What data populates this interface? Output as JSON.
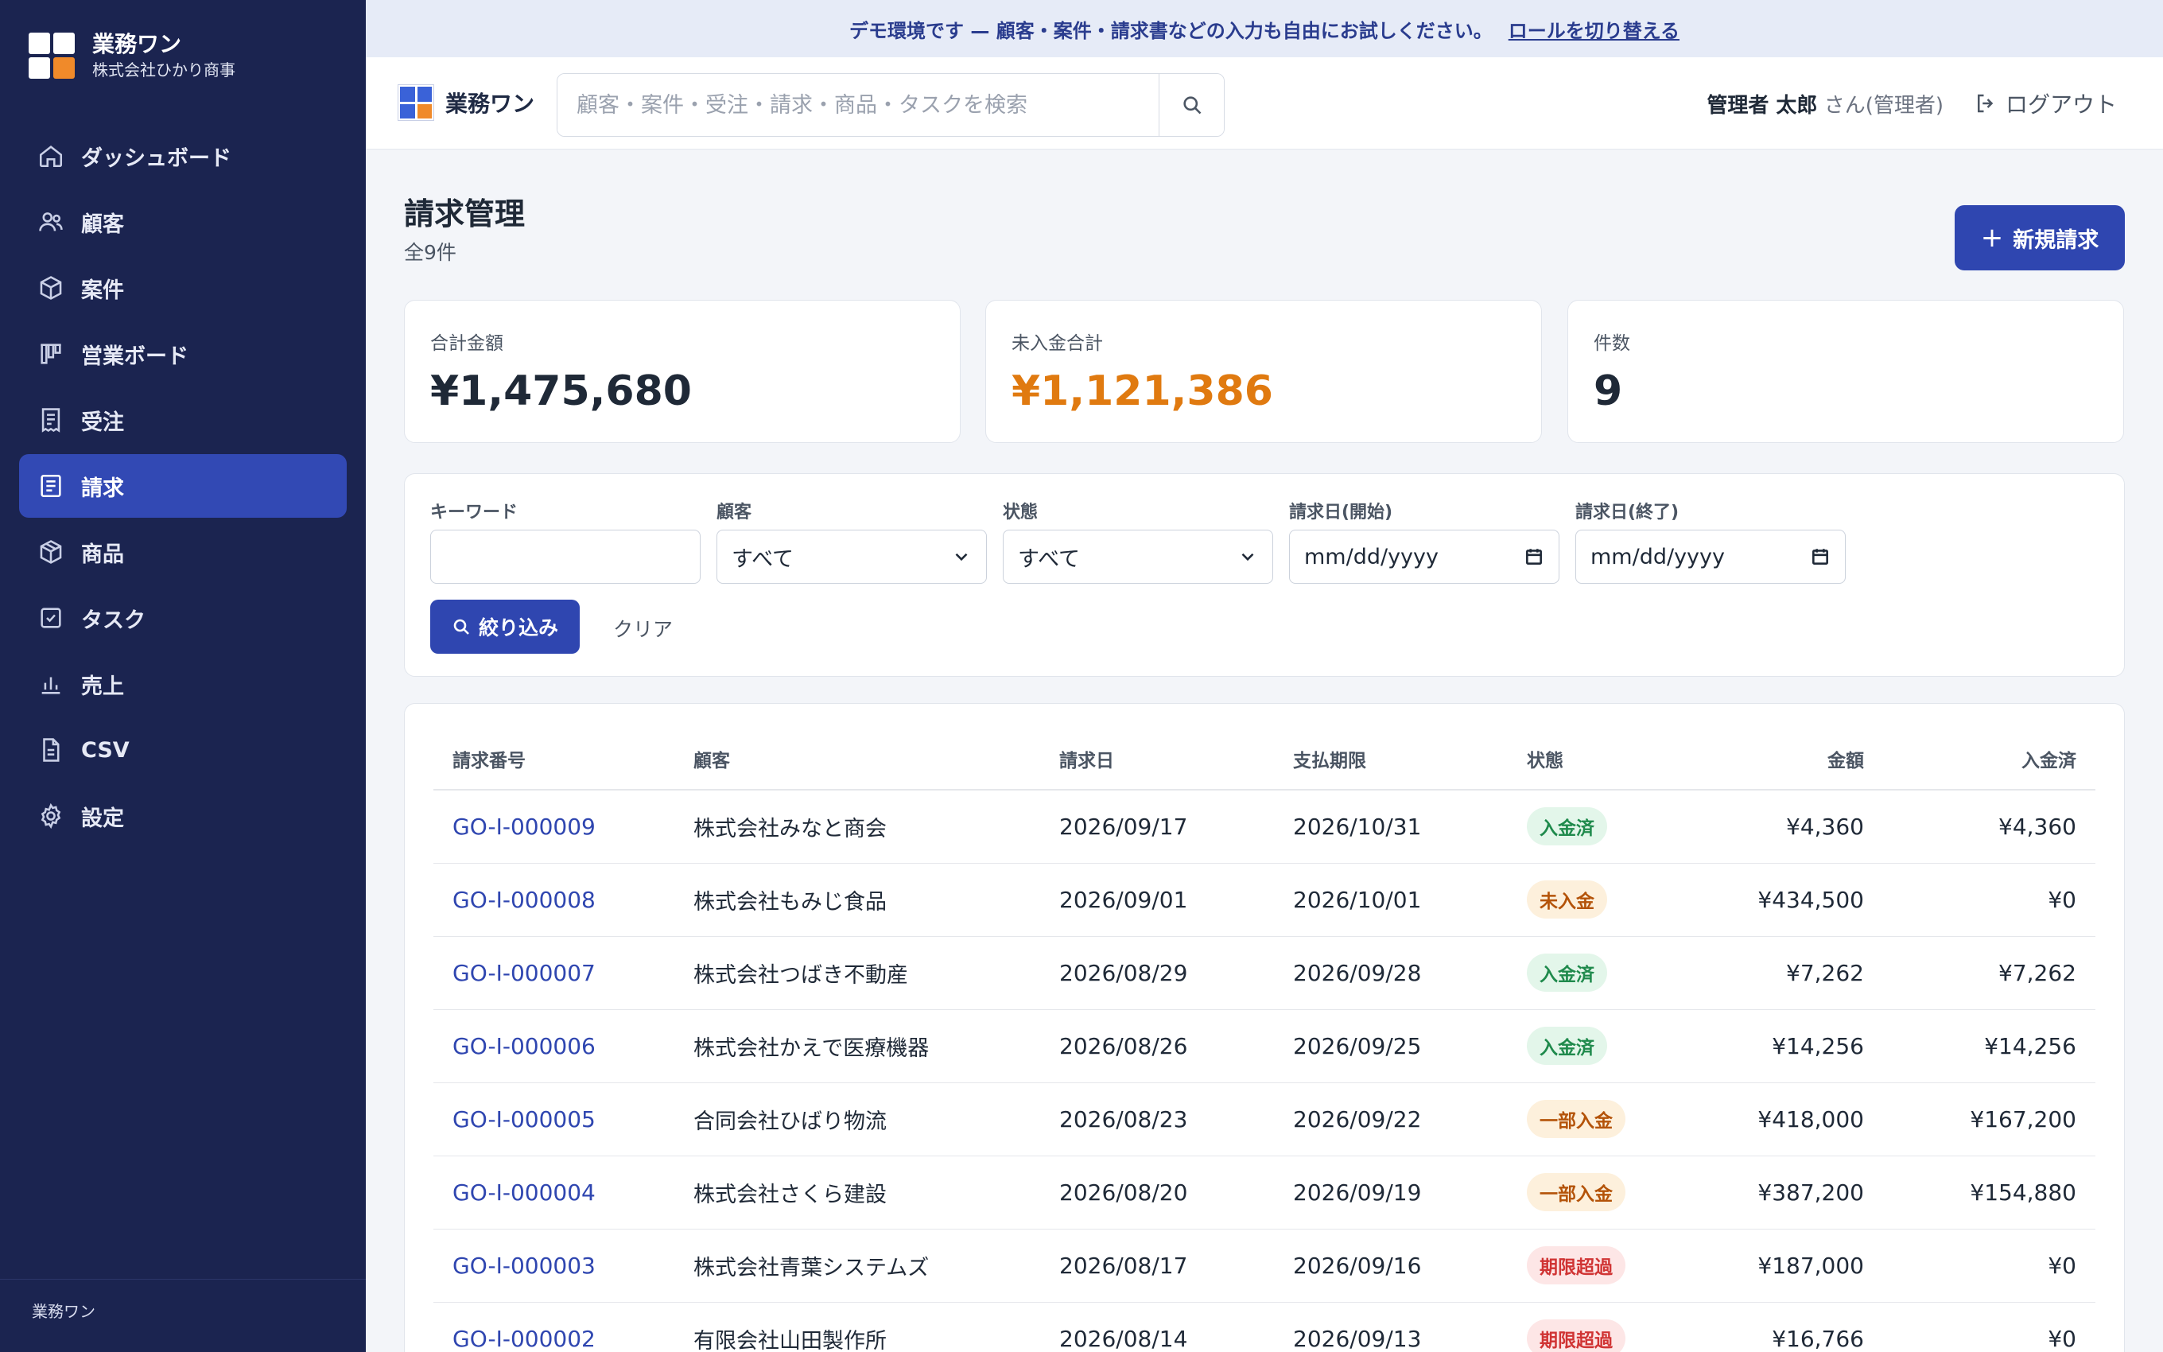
{
  "sidebar": {
    "brand_name": "業務ワン",
    "company": "株式会社ひかり商事",
    "items": [
      {
        "label": "ダッシュボード",
        "icon": "home-icon"
      },
      {
        "label": "顧客",
        "icon": "users-icon"
      },
      {
        "label": "案件",
        "icon": "box-icon"
      },
      {
        "label": "営業ボード",
        "icon": "kanban-icon"
      },
      {
        "label": "受注",
        "icon": "receipt-icon"
      },
      {
        "label": "請求",
        "icon": "invoice-icon",
        "active": true
      },
      {
        "label": "商品",
        "icon": "package-icon"
      },
      {
        "label": "タスク",
        "icon": "checkbox-icon"
      },
      {
        "label": "売上",
        "icon": "bar-chart-icon"
      },
      {
        "label": "CSV",
        "icon": "file-icon"
      },
      {
        "label": "設定",
        "icon": "gear-icon"
      }
    ],
    "footer": "業務ワン"
  },
  "banner": {
    "text": "デモ環境です — 顧客・案件・請求書などの入力も自由にお試しください。",
    "link": "ロールを切り替える"
  },
  "header": {
    "brand_name": "業務ワン",
    "search_placeholder": "顧客・案件・受注・請求・商品・タスクを検索",
    "user_name": "管理者 太郎",
    "user_suffix": " さん(管理者)",
    "logout": "ログアウト"
  },
  "page": {
    "title": "請求管理",
    "count": "全9件",
    "new_button": "新規請求"
  },
  "summary": [
    {
      "label": "合計金額",
      "value": "¥1,475,680",
      "color": "#1f2937"
    },
    {
      "label": "未入金合計",
      "value": "¥1,121,386",
      "color": "#e07a10"
    },
    {
      "label": "件数",
      "value": "9",
      "color": "#1f2937"
    }
  ],
  "filters": {
    "keyword_label": "キーワード",
    "keyword_value": "",
    "customer_label": "顧客",
    "customer_value": "すべて",
    "status_label": "状態",
    "status_value": "すべて",
    "date_from_label": "請求日(開始)",
    "date_from_value": "mm/dd/yyyy",
    "date_to_label": "請求日(終了)",
    "date_to_value": "mm/dd/yyyy",
    "apply_button": "絞り込み",
    "clear_button": "クリア"
  },
  "table": {
    "headers": [
      "請求番号",
      "顧客",
      "請求日",
      "支払期限",
      "状態",
      "金額",
      "入金済"
    ],
    "rows": [
      {
        "no": "GO-I-000009",
        "customer": "株式会社みなと商会",
        "date": "2026/09/17",
        "due": "2026/10/31",
        "status": "入金済",
        "amount": "¥4,360",
        "paid": "¥4,360"
      },
      {
        "no": "GO-I-000008",
        "customer": "株式会社もみじ食品",
        "date": "2026/09/01",
        "due": "2026/10/01",
        "status": "未入金",
        "amount": "¥434,500",
        "paid": "¥0"
      },
      {
        "no": "GO-I-000007",
        "customer": "株式会社つばき不動産",
        "date": "2026/08/29",
        "due": "2026/09/28",
        "status": "入金済",
        "amount": "¥7,262",
        "paid": "¥7,262"
      },
      {
        "no": "GO-I-000006",
        "customer": "株式会社かえで医療機器",
        "date": "2026/08/26",
        "due": "2026/09/25",
        "status": "入金済",
        "amount": "¥14,256",
        "paid": "¥14,256"
      },
      {
        "no": "GO-I-000005",
        "customer": "合同会社ひばり物流",
        "date": "2026/08/23",
        "due": "2026/09/22",
        "status": "一部入金",
        "amount": "¥418,000",
        "paid": "¥167,200"
      },
      {
        "no": "GO-I-000004",
        "customer": "株式会社さくら建設",
        "date": "2026/08/20",
        "due": "2026/09/19",
        "status": "一部入金",
        "amount": "¥387,200",
        "paid": "¥154,880"
      },
      {
        "no": "GO-I-000003",
        "customer": "株式会社青葉システムズ",
        "date": "2026/08/17",
        "due": "2026/09/16",
        "status": "期限超過",
        "amount": "¥187,000",
        "paid": "¥0"
      },
      {
        "no": "GO-I-000002",
        "customer": "有限会社山田製作所",
        "date": "2026/08/14",
        "due": "2026/09/13",
        "status": "期限超過",
        "amount": "¥16,766",
        "paid": "¥0"
      }
    ]
  },
  "status_colors": {
    "入金済": {
      "bg": "#e3f6ea",
      "fg": "#1f8a4c"
    },
    "未入金": {
      "bg": "#fdf0dc",
      "fg": "#b45309"
    },
    "一部入金": {
      "bg": "#fdf0dc",
      "fg": "#b45309"
    },
    "期限超過": {
      "bg": "#fde6e6",
      "fg": "#d03434"
    }
  },
  "colors": {
    "sidebar_bg": "#1b2450",
    "accent": "#2f46b0",
    "logo_blue": "#3a62d8",
    "logo_orange": "#f08a2a"
  }
}
